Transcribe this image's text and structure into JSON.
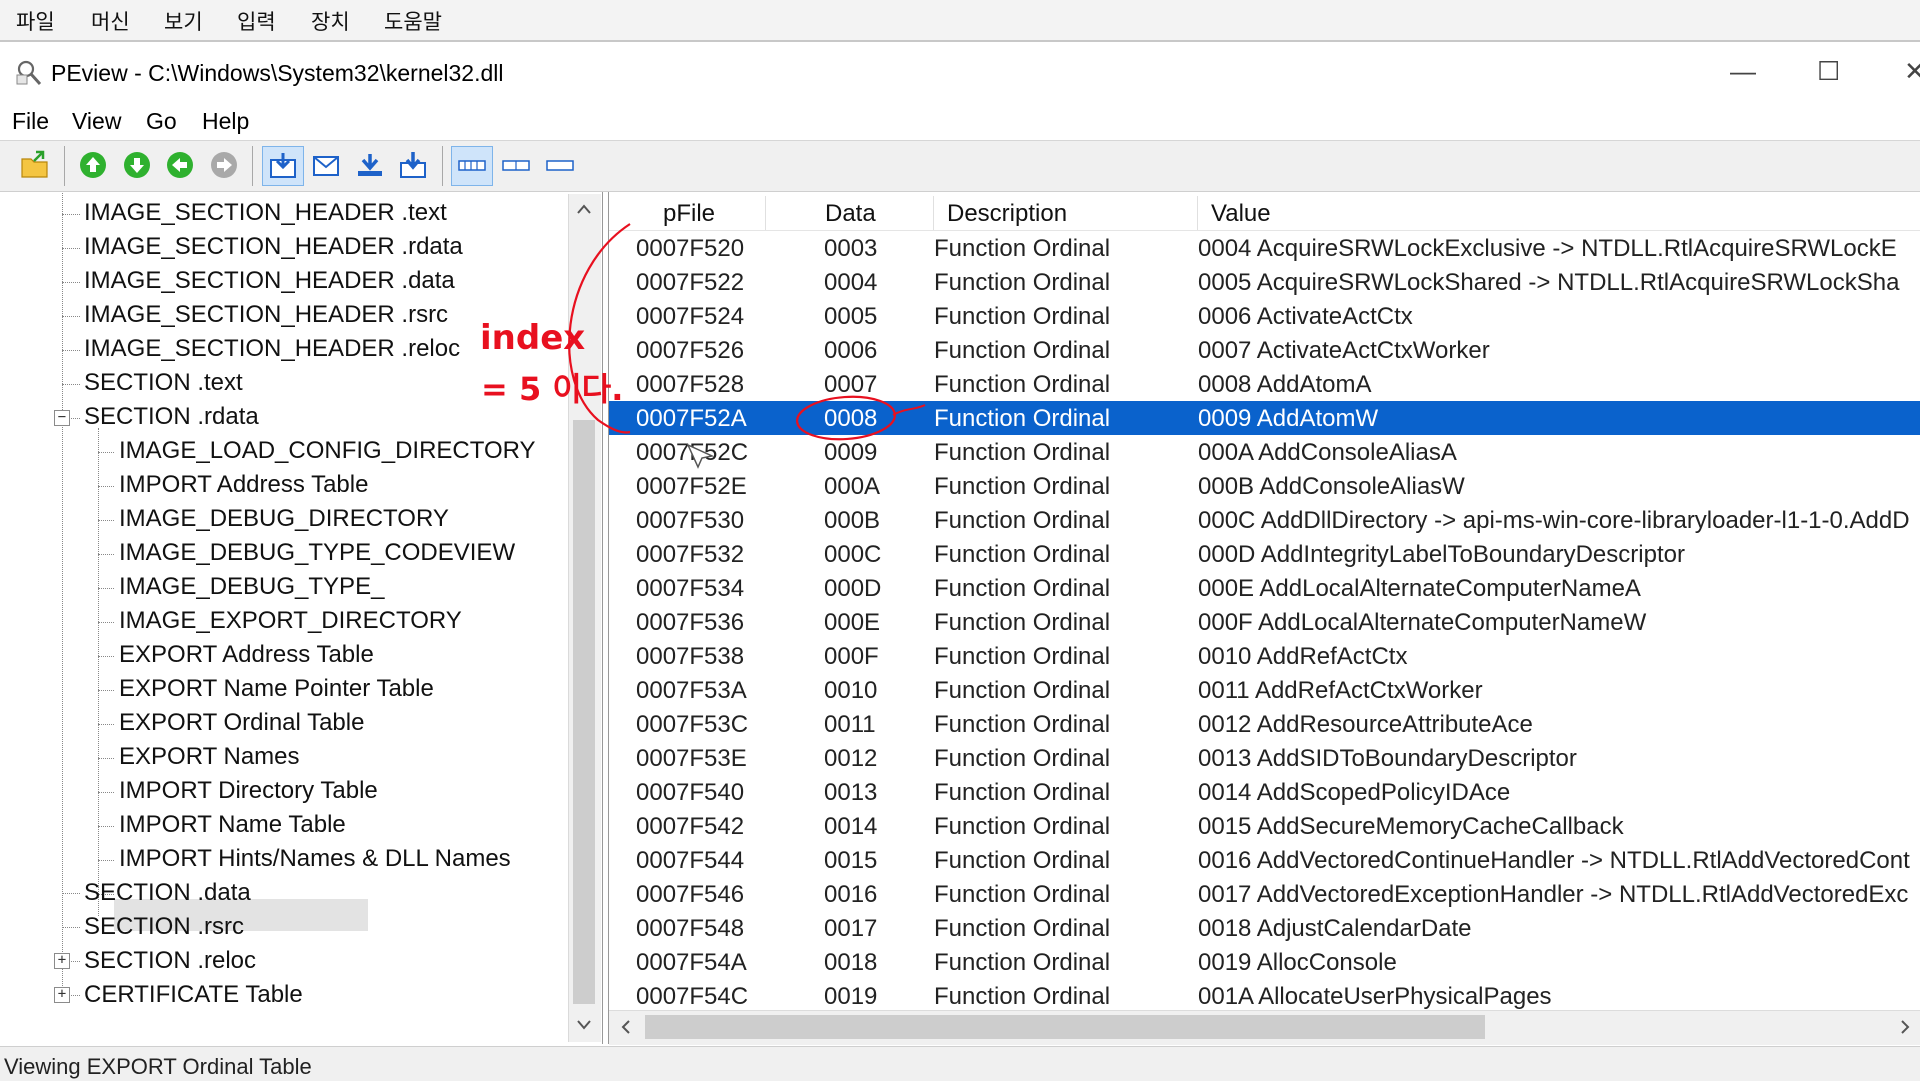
{
  "host_menu": [
    "파일",
    "머신",
    "보기",
    "입력",
    "장치",
    "도움말"
  ],
  "window": {
    "title": "PEview - C:\\Windows\\System32\\kernel32.dll",
    "app_icon": "magnifier-icon"
  },
  "menu": {
    "file": "File",
    "view": "View",
    "go": "Go",
    "help": "Help"
  },
  "toolbar_icons": [
    "open-folder-icon",
    "nav-up-icon",
    "nav-down-icon",
    "nav-back-icon",
    "nav-forward-icon",
    "view-download-icon",
    "view-envelope-icon",
    "view-arrow-down-icon",
    "view-arrow-download-icon",
    "layout-byte-icon",
    "layout-word-icon",
    "layout-dword-icon"
  ],
  "tree": {
    "items": [
      {
        "label": "IMAGE_SECTION_HEADER .text"
      },
      {
        "label": "IMAGE_SECTION_HEADER .rdata"
      },
      {
        "label": "IMAGE_SECTION_HEADER .data"
      },
      {
        "label": "IMAGE_SECTION_HEADER .rsrc"
      },
      {
        "label": "IMAGE_SECTION_HEADER .reloc"
      },
      {
        "label": "SECTION .text"
      },
      {
        "label": "SECTION .rdata"
      },
      {
        "label": "IMAGE_LOAD_CONFIG_DIRECTORY"
      },
      {
        "label": "IMPORT Address Table"
      },
      {
        "label": "IMAGE_DEBUG_DIRECTORY"
      },
      {
        "label": "IMAGE_DEBUG_TYPE_CODEVIEW"
      },
      {
        "label": "IMAGE_DEBUG_TYPE_"
      },
      {
        "label": "IMAGE_EXPORT_DIRECTORY"
      },
      {
        "label": "EXPORT Address Table"
      },
      {
        "label": "EXPORT Name Pointer Table"
      },
      {
        "label": "EXPORT Ordinal Table"
      },
      {
        "label": "EXPORT Names"
      },
      {
        "label": "IMPORT Directory Table"
      },
      {
        "label": "IMPORT Name Table"
      },
      {
        "label": "IMPORT Hints/Names & DLL Names"
      },
      {
        "label": "SECTION .data"
      },
      {
        "label": "SECTION .rsrc"
      },
      {
        "label": "SECTION .reloc"
      },
      {
        "label": "CERTIFICATE Table"
      }
    ],
    "selected": "EXPORT Ordinal Table"
  },
  "list": {
    "columns": [
      "pFile",
      "Data",
      "Description",
      "Value"
    ],
    "rows": [
      {
        "pfile": "0007F520",
        "data": "0003",
        "desc": "Function Ordinal",
        "value": "0004  AcquireSRWLockExclusive -> NTDLL.RtlAcquireSRWLockE"
      },
      {
        "pfile": "0007F522",
        "data": "0004",
        "desc": "Function Ordinal",
        "value": "0005  AcquireSRWLockShared -> NTDLL.RtlAcquireSRWLockSha"
      },
      {
        "pfile": "0007F524",
        "data": "0005",
        "desc": "Function Ordinal",
        "value": "0006  ActivateActCtx"
      },
      {
        "pfile": "0007F526",
        "data": "0006",
        "desc": "Function Ordinal",
        "value": "0007  ActivateActCtxWorker"
      },
      {
        "pfile": "0007F528",
        "data": "0007",
        "desc": "Function Ordinal",
        "value": "0008  AddAtomA"
      },
      {
        "pfile": "0007F52A",
        "data": "0008",
        "desc": "Function Ordinal",
        "value": "0009  AddAtomW",
        "selected": true
      },
      {
        "pfile": "0007F52C",
        "data": "0009",
        "desc": "Function Ordinal",
        "value": "000A  AddConsoleAliasA"
      },
      {
        "pfile": "0007F52E",
        "data": "000A",
        "desc": "Function Ordinal",
        "value": "000B  AddConsoleAliasW"
      },
      {
        "pfile": "0007F530",
        "data": "000B",
        "desc": "Function Ordinal",
        "value": "000C  AddDllDirectory -> api-ms-win-core-libraryloader-l1-1-0.AddD"
      },
      {
        "pfile": "0007F532",
        "data": "000C",
        "desc": "Function Ordinal",
        "value": "000D  AddIntegrityLabelToBoundaryDescriptor"
      },
      {
        "pfile": "0007F534",
        "data": "000D",
        "desc": "Function Ordinal",
        "value": "000E  AddLocalAlternateComputerNameA"
      },
      {
        "pfile": "0007F536",
        "data": "000E",
        "desc": "Function Ordinal",
        "value": "000F  AddLocalAlternateComputerNameW"
      },
      {
        "pfile": "0007F538",
        "data": "000F",
        "desc": "Function Ordinal",
        "value": "0010  AddRefActCtx"
      },
      {
        "pfile": "0007F53A",
        "data": "0010",
        "desc": "Function Ordinal",
        "value": "0011  AddRefActCtxWorker"
      },
      {
        "pfile": "0007F53C",
        "data": "0011",
        "desc": "Function Ordinal",
        "value": "0012  AddResourceAttributeAce"
      },
      {
        "pfile": "0007F53E",
        "data": "0012",
        "desc": "Function Ordinal",
        "value": "0013  AddSIDToBoundaryDescriptor"
      },
      {
        "pfile": "0007F540",
        "data": "0013",
        "desc": "Function Ordinal",
        "value": "0014  AddScopedPolicyIDAce"
      },
      {
        "pfile": "0007F542",
        "data": "0014",
        "desc": "Function Ordinal",
        "value": "0015  AddSecureMemoryCacheCallback"
      },
      {
        "pfile": "0007F544",
        "data": "0015",
        "desc": "Function Ordinal",
        "value": "0016  AddVectoredContinueHandler -> NTDLL.RtlAddVectoredCont"
      },
      {
        "pfile": "0007F546",
        "data": "0016",
        "desc": "Function Ordinal",
        "value": "0017  AddVectoredExceptionHandler -> NTDLL.RtlAddVectoredExc"
      },
      {
        "pfile": "0007F548",
        "data": "0017",
        "desc": "Function Ordinal",
        "value": "0018  AdjustCalendarDate"
      },
      {
        "pfile": "0007F54A",
        "data": "0018",
        "desc": "Function Ordinal",
        "value": "0019  AllocConsole"
      },
      {
        "pfile": "0007F54C",
        "data": "0019",
        "desc": "Function Ordinal",
        "value": "001A  AllocateUserPhysicalPages"
      }
    ]
  },
  "annotation": {
    "line1": "index",
    "line2": "= 5 이다."
  },
  "status": "Viewing EXPORT Ordinal Table",
  "colors": {
    "selection": "#0a62cc",
    "annotation": "#e8101f"
  }
}
